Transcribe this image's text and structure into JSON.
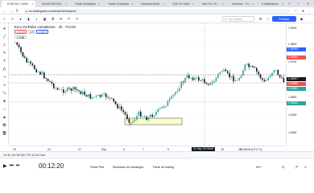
{
  "browser": {
    "tabs": [
      {
        "label": "EURCAD 1.55951 ↑",
        "color": "#26a69a"
      },
      {
        "label": "EAUR/USD IDEA pr",
        "color": "#f7931a"
      },
      {
        "label": "Trader ExtraDepr",
        "color": "#787b86"
      },
      {
        "label": "Trader ExtraDepr",
        "color": "#e53935"
      },
      {
        "label": "Facebook/Edile",
        "color": "#1877f2"
      },
      {
        "label": "CAD Frr SIAO",
        "color": "#d32f2f"
      },
      {
        "label": "Sea TGL +5 MG",
        "color": "#7b1fa2"
      },
      {
        "label": "Dommes - The Tr",
        "color": "#131722"
      },
      {
        "label": "5 notifications",
        "color": "#2962ff"
      }
    ],
    "address": "es.tradingview.com/chart/xBhwdpUz/"
  },
  "toolbar": {
    "search_placeholder": "Su nombre",
    "publish_label": "Publicar"
  },
  "chart": {
    "symbol_title": "Euro Fx/Dólar canadiense · 4h · FACM",
    "bid": "1.5595",
    "spread": "4.9",
    "ask": "1.5597",
    "mini_value": "1.2288"
  },
  "price_axis": {
    "labels": [
      "1.6000",
      "1.5800",
      "1.5700",
      "1.5600",
      "1.5500",
      "1.5400",
      "1.5300"
    ],
    "tags": [
      {
        "text": "1.56953",
        "color": "#2962ff"
      },
      {
        "text": "1.56561",
        "color": "#ef5350"
      },
      {
        "text": "1.55917",
        "color": "#131722"
      },
      {
        "text": "1.55882",
        "color": "#ef5350"
      },
      {
        "text": "1.55851",
        "color": "#26a69a"
      },
      {
        "text": "1.55442",
        "color": "#26a69a"
      }
    ]
  },
  "time_axis": {
    "labels": [
      "19",
      "24",
      "27",
      "Sep",
      "3",
      "7",
      "9",
      "14",
      "18",
      "21",
      "25",
      "29"
    ],
    "cursor_time": "11 Sep '20  05:00",
    "clock": "08:35:06 (UTC+1)"
  },
  "replay": {
    "timer": "00:12:20",
    "links": [
      "Filtrar Pine",
      "Simulador de estrategia",
      "Panel de trading"
    ]
  },
  "icons": {
    "back": "back-arrow-icon",
    "forward": "forward-arrow-icon",
    "reload": "reload-icon",
    "search": "search-icon",
    "crosshair": "crosshair-icon",
    "trendline": "trendline-icon"
  },
  "colors": {
    "bull": "#26a69a",
    "bear": "#131722",
    "zone": "#fffbcc",
    "accent": "#2962ff"
  }
}
